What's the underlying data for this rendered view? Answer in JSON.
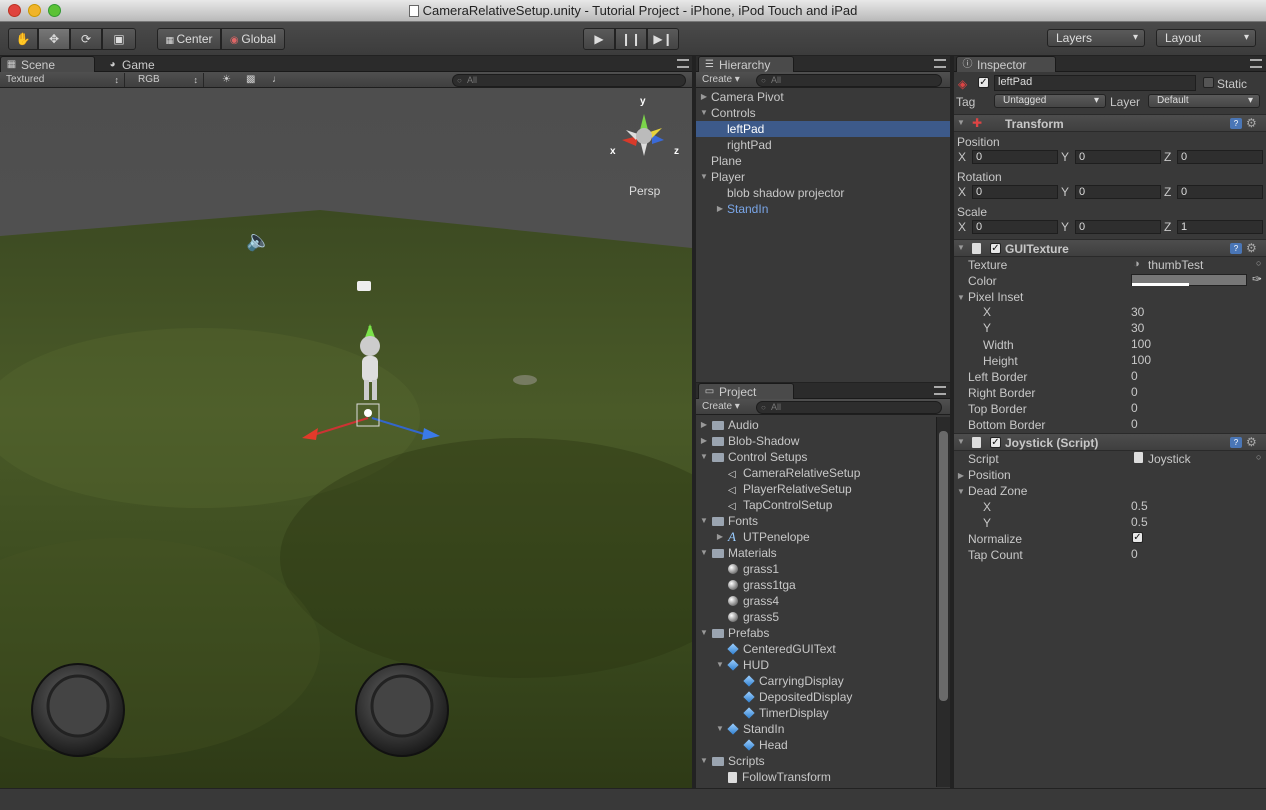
{
  "window": {
    "title": "CameraRelativeSetup.unity - Tutorial Project - iPhone, iPod Touch and iPad"
  },
  "toolbar": {
    "pivot_label": "Center",
    "space_label": "Global",
    "layers_label": "Layers",
    "layout_label": "Layout"
  },
  "scene": {
    "tab_scene": "Scene",
    "tab_game": "Game",
    "render_mode": "Textured",
    "channel": "RGB",
    "search_placeholder": "All",
    "gizmo_label": "Persp",
    "axis_x": "x",
    "axis_y": "y",
    "axis_z": "z"
  },
  "hierarchy": {
    "tab": "Hierarchy",
    "create_label": "Create",
    "search_placeholder": "All",
    "items": [
      {
        "label": "Camera Pivot"
      },
      {
        "label": "Controls"
      },
      {
        "label": "leftPad"
      },
      {
        "label": "rightPad"
      },
      {
        "label": "Plane"
      },
      {
        "label": "Player"
      },
      {
        "label": "blob shadow projector"
      },
      {
        "label": "StandIn"
      }
    ]
  },
  "project": {
    "tab": "Project",
    "create_label": "Create",
    "search_placeholder": "All",
    "items": [
      {
        "label": "Audio"
      },
      {
        "label": "Blob-Shadow"
      },
      {
        "label": "Control Setups"
      },
      {
        "label": "CameraRelativeSetup"
      },
      {
        "label": "PlayerRelativeSetup"
      },
      {
        "label": "TapControlSetup"
      },
      {
        "label": "Fonts"
      },
      {
        "label": "UTPenelope"
      },
      {
        "label": "Materials"
      },
      {
        "label": "grass1"
      },
      {
        "label": "grass1tga"
      },
      {
        "label": "grass4"
      },
      {
        "label": "grass5"
      },
      {
        "label": "Prefabs"
      },
      {
        "label": "CenteredGUIText"
      },
      {
        "label": "HUD"
      },
      {
        "label": "CarryingDisplay"
      },
      {
        "label": "DepositedDisplay"
      },
      {
        "label": "TimerDisplay"
      },
      {
        "label": "StandIn"
      },
      {
        "label": "Head"
      },
      {
        "label": "Scripts"
      },
      {
        "label": "FollowTransform"
      }
    ]
  },
  "inspector": {
    "tab": "Inspector",
    "object_name": "leftPad",
    "static_label": "Static",
    "tag_label": "Tag",
    "tag_value": "Untagged",
    "layer_label": "Layer",
    "layer_value": "Default",
    "transform": {
      "title": "Transform",
      "position_label": "Position",
      "rotation_label": "Rotation",
      "scale_label": "Scale",
      "x": "X",
      "y": "Y",
      "z": "Z",
      "position": [
        "0",
        "0",
        "0"
      ],
      "rotation": [
        "0",
        "0",
        "0"
      ],
      "scale": [
        "0",
        "0",
        "1"
      ]
    },
    "guitexture": {
      "title": "GUITexture",
      "texture_label": "Texture",
      "texture_value": "thumbTest",
      "color_label": "Color",
      "pixel_inset_label": "Pixel Inset",
      "x_label": "X",
      "x_value": "30",
      "y_label": "Y",
      "y_value": "30",
      "width_label": "Width",
      "width_value": "100",
      "height_label": "Height",
      "height_value": "100",
      "left_border_label": "Left Border",
      "left_border_value": "0",
      "right_border_label": "Right Border",
      "right_border_value": "0",
      "top_border_label": "Top Border",
      "top_border_value": "0",
      "bottom_border_label": "Bottom Border",
      "bottom_border_value": "0"
    },
    "joystick": {
      "title": "Joystick (Script)",
      "script_label": "Script",
      "script_value": "Joystick",
      "position_label": "Position",
      "dead_zone_label": "Dead Zone",
      "x_label": "X",
      "x_value": "0.5",
      "y_label": "Y",
      "y_value": "0.5",
      "normalize_label": "Normalize",
      "tap_count_label": "Tap Count",
      "tap_count_value": "0"
    }
  }
}
